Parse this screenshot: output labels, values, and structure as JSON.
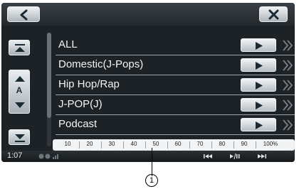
{
  "header": {
    "back_icon": "back-arrow-icon",
    "close_icon": "close-x-icon"
  },
  "sidebar": {
    "top_icon": "jump-top-icon",
    "up_icon": "page-up-icon",
    "index_letter": "A",
    "down_icon": "page-down-icon",
    "bottom_icon": "jump-bottom-icon"
  },
  "list": {
    "items": [
      {
        "label": "ALL"
      },
      {
        "label": "Domestic(J-Pops)"
      },
      {
        "label": "Hip Hop/Rap"
      },
      {
        "label": "J-POP(J)"
      },
      {
        "label": "Podcast"
      }
    ],
    "play_icon": "play-icon",
    "more_icon": "double-chevron-right-icon"
  },
  "scroll_scale": {
    "ticks": [
      "10",
      "20",
      "30",
      "40",
      "50",
      "60",
      "70",
      "80",
      "90",
      "100%"
    ]
  },
  "status": {
    "time": "1:07",
    "media_controls": [
      "previous-track-icon",
      "play-pause-icon",
      "next-track-icon"
    ]
  },
  "callout": {
    "number": "1"
  },
  "colors": {
    "screen_bg": "#1d2226",
    "button_light": "#e9edf0",
    "divider": "#9aa3a9"
  }
}
